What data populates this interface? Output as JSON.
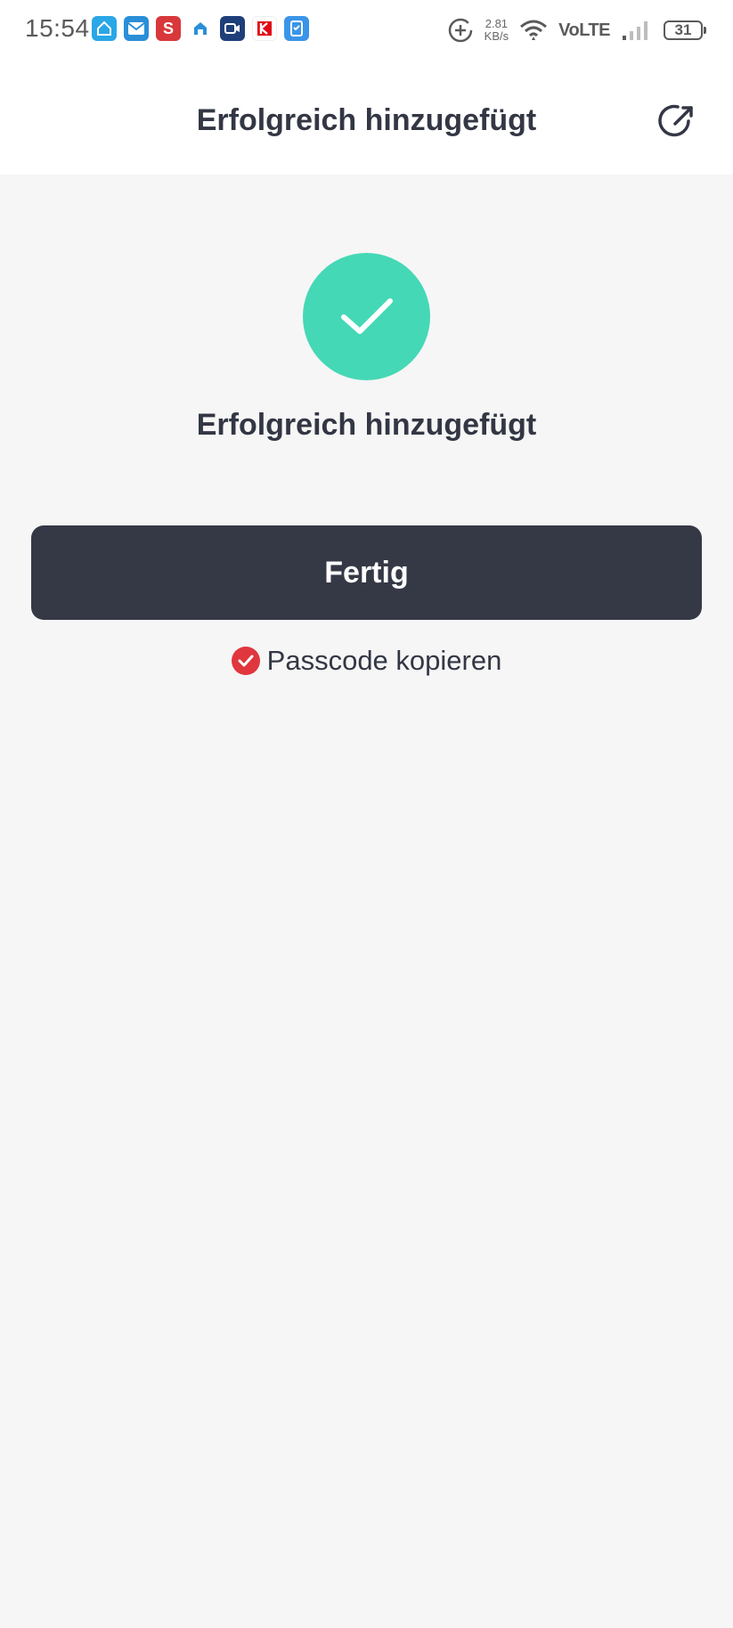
{
  "status_bar": {
    "time": "15:54",
    "net_speed_value": "2.81",
    "net_speed_unit": "KB/s",
    "network_type": "VoLTE",
    "battery_level": "31",
    "notification_icons": [
      "home-app-icon",
      "mail-icon",
      "s-app-icon",
      "smart-home-icon",
      "video-icon",
      "kaufland-icon",
      "security-app-icon"
    ]
  },
  "header": {
    "title": "Erfolgreich hinzugefügt"
  },
  "content": {
    "success_title": "Erfolgreich hinzugefügt",
    "done_label": "Fertig",
    "passcode_label": "Passcode kopieren",
    "passcode_checked": true
  },
  "colors": {
    "success": "#45d8b6",
    "button": "#353946",
    "checkbox": "#e0363e",
    "background": "#f6f6f6",
    "text": "#333744"
  }
}
